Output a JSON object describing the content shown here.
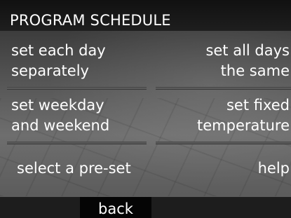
{
  "header": {
    "title": "PROGRAM SCHEDULE"
  },
  "menu": {
    "each_day": [
      "set each day",
      "separately"
    ],
    "all_days": [
      "set all days",
      "the same"
    ],
    "weekday_weekend": [
      "set weekday",
      "and weekend"
    ],
    "fixed_temp": [
      "set fixed",
      "temperature"
    ],
    "preset": "select a pre-set",
    "help": "help"
  },
  "footer": {
    "back_label": "back"
  }
}
